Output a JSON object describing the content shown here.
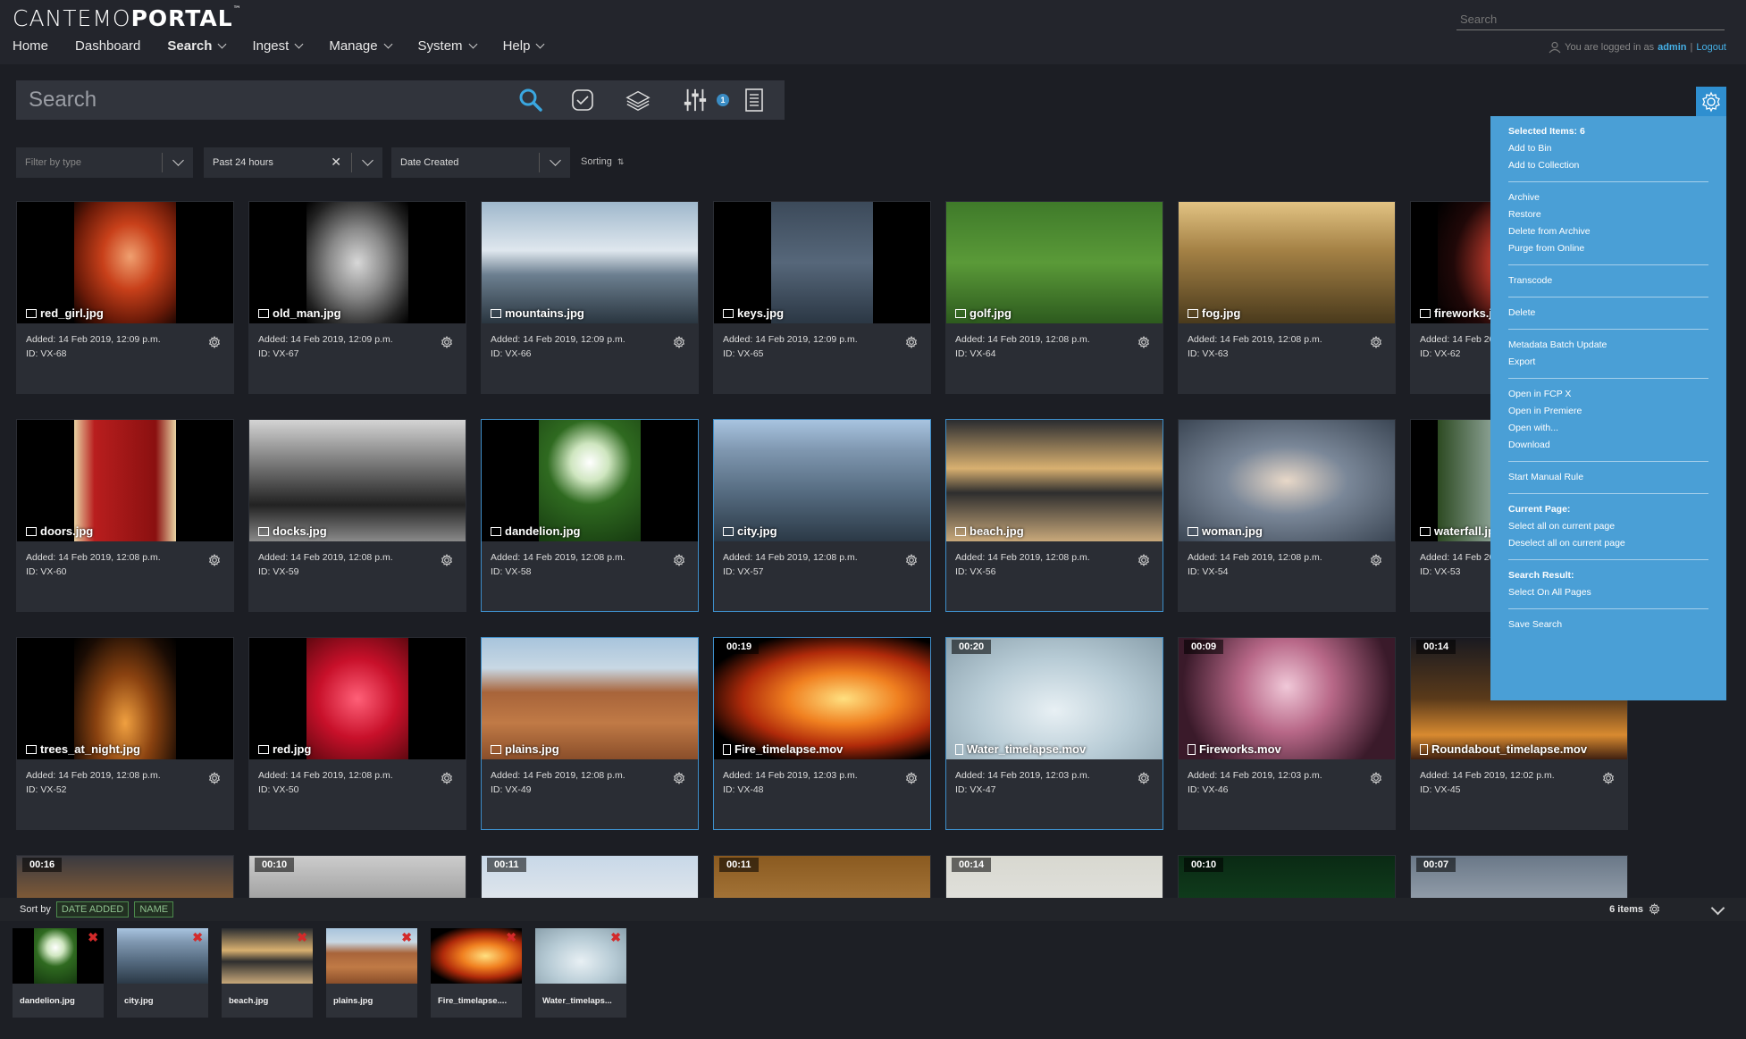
{
  "app": {
    "logo_light": "CANTEMO",
    "logo_bold": "PORTAL",
    "logo_tm": "™"
  },
  "nav": {
    "items": [
      {
        "label": "Home",
        "dropdown": false
      },
      {
        "label": "Dashboard",
        "dropdown": false
      },
      {
        "label": "Search",
        "dropdown": true,
        "active": true
      },
      {
        "label": "Ingest",
        "dropdown": true
      },
      {
        "label": "Manage",
        "dropdown": true
      },
      {
        "label": "System",
        "dropdown": true
      },
      {
        "label": "Help",
        "dropdown": true
      }
    ],
    "search_placeholder": "Search",
    "login_text": "You are logged in as",
    "user": "admin",
    "separator": "|",
    "logout": "Logout"
  },
  "search": {
    "placeholder": "Search",
    "filter_badge": "1"
  },
  "filters": {
    "type_placeholder": "Filter by type",
    "time_value": "Past 24 hours",
    "date_value": "Date Created",
    "sorting_label": "Sorting",
    "clear_symbol": "✕"
  },
  "colors": {
    "accent": "#4a9fd6",
    "selected_border": "#3d8dc8",
    "background": "#1c1e24",
    "card": "#2a2d34"
  },
  "assets": [
    {
      "name": "red_girl.jpg",
      "added": "Added: 14 Feb 2019, 12:09 p.m.",
      "id": "ID: VX-68",
      "kind": "image",
      "selected": false,
      "duration": ""
    },
    {
      "name": "old_man.jpg",
      "added": "Added: 14 Feb 2019, 12:09 p.m.",
      "id": "ID: VX-67",
      "kind": "image",
      "selected": false,
      "duration": ""
    },
    {
      "name": "mountains.jpg",
      "added": "Added: 14 Feb 2019, 12:09 p.m.",
      "id": "ID: VX-66",
      "kind": "image",
      "selected": false,
      "duration": ""
    },
    {
      "name": "keys.jpg",
      "added": "Added: 14 Feb 2019, 12:09 p.m.",
      "id": "ID: VX-65",
      "kind": "image",
      "selected": false,
      "duration": ""
    },
    {
      "name": "golf.jpg",
      "added": "Added: 14 Feb 2019, 12:08 p.m.",
      "id": "ID: VX-64",
      "kind": "image",
      "selected": false,
      "duration": ""
    },
    {
      "name": "fog.jpg",
      "added": "Added: 14 Feb 2019, 12:08 p.m.",
      "id": "ID: VX-63",
      "kind": "image",
      "selected": false,
      "duration": ""
    },
    {
      "name": "fireworks.jpg",
      "added": "Added: 14 Feb 2019, 12:08 p.m.",
      "id": "ID: VX-62",
      "kind": "image",
      "selected": false,
      "duration": ""
    },
    {
      "name": "doors.jpg",
      "added": "Added: 14 Feb 2019, 12:08 p.m.",
      "id": "ID: VX-60",
      "kind": "image",
      "selected": false,
      "duration": ""
    },
    {
      "name": "docks.jpg",
      "added": "Added: 14 Feb 2019, 12:08 p.m.",
      "id": "ID: VX-59",
      "kind": "image",
      "selected": false,
      "duration": ""
    },
    {
      "name": "dandelion.jpg",
      "added": "Added: 14 Feb 2019, 12:08 p.m.",
      "id": "ID: VX-58",
      "kind": "image",
      "selected": true,
      "duration": ""
    },
    {
      "name": "city.jpg",
      "added": "Added: 14 Feb 2019, 12:08 p.m.",
      "id": "ID: VX-57",
      "kind": "image",
      "selected": true,
      "duration": ""
    },
    {
      "name": "beach.jpg",
      "added": "Added: 14 Feb 2019, 12:08 p.m.",
      "id": "ID: VX-56",
      "kind": "image",
      "selected": true,
      "duration": ""
    },
    {
      "name": "woman.jpg",
      "added": "Added: 14 Feb 2019, 12:08 p.m.",
      "id": "ID: VX-54",
      "kind": "image",
      "selected": false,
      "duration": ""
    },
    {
      "name": "waterfall.jpg",
      "added": "Added: 14 Feb 2019, 12:08 p.m.",
      "id": "ID: VX-53",
      "kind": "image",
      "selected": false,
      "duration": ""
    },
    {
      "name": "trees_at_night.jpg",
      "added": "Added: 14 Feb 2019, 12:08 p.m.",
      "id": "ID: VX-52",
      "kind": "image",
      "selected": false,
      "duration": ""
    },
    {
      "name": "red.jpg",
      "added": "Added: 14 Feb 2019, 12:08 p.m.",
      "id": "ID: VX-50",
      "kind": "image",
      "selected": false,
      "duration": ""
    },
    {
      "name": "plains.jpg",
      "added": "Added: 14 Feb 2019, 12:08 p.m.",
      "id": "ID: VX-49",
      "kind": "image",
      "selected": true,
      "duration": ""
    },
    {
      "name": "Fire_timelapse.mov",
      "added": "Added: 14 Feb 2019, 12:03 p.m.",
      "id": "ID: VX-48",
      "kind": "video",
      "selected": true,
      "duration": "00:19"
    },
    {
      "name": "Water_timelapse.mov",
      "added": "Added: 14 Feb 2019, 12:03 p.m.",
      "id": "ID: VX-47",
      "kind": "video",
      "selected": true,
      "duration": "00:20"
    },
    {
      "name": "Fireworks.mov",
      "added": "Added: 14 Feb 2019, 12:03 p.m.",
      "id": "ID: VX-46",
      "kind": "video",
      "selected": false,
      "duration": "00:09"
    },
    {
      "name": "Roundabout_timelapse.mov",
      "added": "Added: 14 Feb 2019, 12:02 p.m.",
      "id": "ID: VX-45",
      "kind": "video",
      "selected": false,
      "duration": "00:14"
    },
    {
      "name": "",
      "added": "",
      "id": "",
      "kind": "video",
      "selected": false,
      "duration": "00:16"
    },
    {
      "name": "",
      "added": "",
      "id": "",
      "kind": "video",
      "selected": false,
      "duration": "00:10"
    },
    {
      "name": "",
      "added": "",
      "id": "",
      "kind": "video",
      "selected": false,
      "duration": "00:11"
    },
    {
      "name": "",
      "added": "",
      "id": "",
      "kind": "video",
      "selected": false,
      "duration": "00:11"
    },
    {
      "name": "",
      "added": "",
      "id": "",
      "kind": "video",
      "selected": false,
      "duration": "00:14"
    },
    {
      "name": "",
      "added": "",
      "id": "",
      "kind": "video",
      "selected": false,
      "duration": "00:10"
    },
    {
      "name": "",
      "added": "",
      "id": "",
      "kind": "video",
      "selected": false,
      "duration": "00:07"
    }
  ],
  "context_menu": {
    "items": [
      {
        "label": "Selected Items: 6",
        "type": "header"
      },
      {
        "label": "Add to Bin",
        "type": "item"
      },
      {
        "label": "Add to Collection",
        "type": "item"
      },
      {
        "type": "sep"
      },
      {
        "label": "Archive",
        "type": "item"
      },
      {
        "label": "Restore",
        "type": "item"
      },
      {
        "label": "Delete from Archive",
        "type": "item"
      },
      {
        "label": "Purge from Online",
        "type": "item"
      },
      {
        "type": "sep"
      },
      {
        "label": "Transcode",
        "type": "item"
      },
      {
        "type": "sep"
      },
      {
        "label": "Delete",
        "type": "item"
      },
      {
        "type": "sep"
      },
      {
        "label": "Metadata Batch Update",
        "type": "item"
      },
      {
        "label": "Export",
        "type": "item"
      },
      {
        "type": "sep"
      },
      {
        "label": "Open in FCP X",
        "type": "item"
      },
      {
        "label": "Open in Premiere",
        "type": "item"
      },
      {
        "label": "Open with...",
        "type": "item"
      },
      {
        "label": "Download",
        "type": "item"
      },
      {
        "type": "sep"
      },
      {
        "label": "Start Manual Rule",
        "type": "item"
      },
      {
        "type": "sep"
      },
      {
        "label": "Current Page:",
        "type": "header"
      },
      {
        "label": "Select all on current page",
        "type": "item"
      },
      {
        "label": "Deselect all on current page",
        "type": "item"
      },
      {
        "type": "sep"
      },
      {
        "label": "Search Result:",
        "type": "header"
      },
      {
        "label": "Select On All Pages",
        "type": "item"
      },
      {
        "type": "sep"
      },
      {
        "label": "Save Search",
        "type": "item"
      }
    ]
  },
  "bin": {
    "sort_label": "Sort by",
    "sort_date": "DATE ADDED",
    "sort_name": "NAME",
    "count": "6 items",
    "remove_symbol": "✖",
    "items": [
      {
        "name": "dandelion.jpg"
      },
      {
        "name": "city.jpg"
      },
      {
        "name": "beach.jpg"
      },
      {
        "name": "plains.jpg"
      },
      {
        "name": "Fire_timelapse...."
      },
      {
        "name": "Water_timelaps..."
      }
    ]
  }
}
